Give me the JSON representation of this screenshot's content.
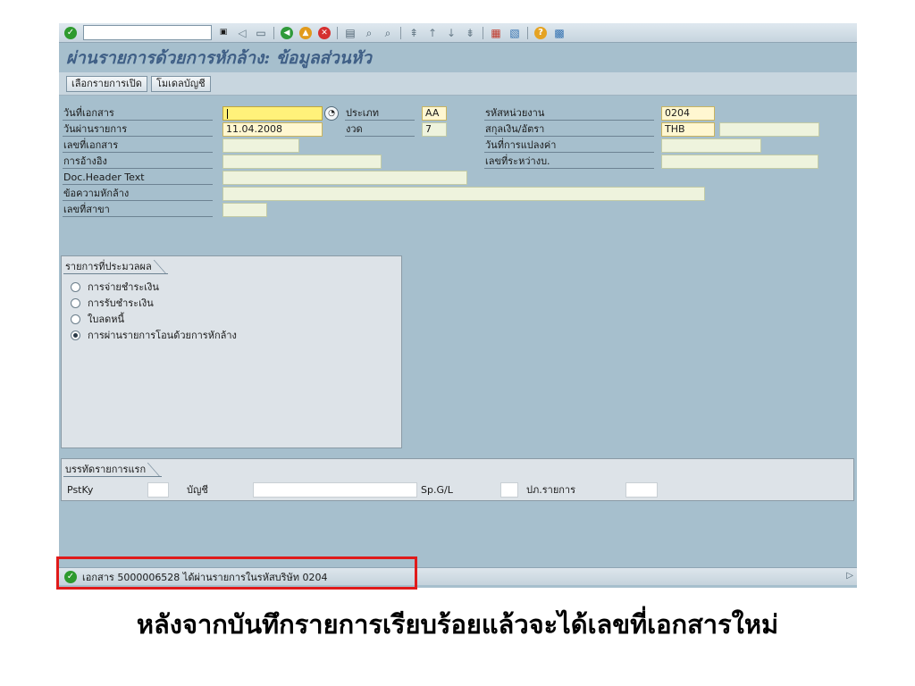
{
  "screen_title": "ผ่านรายการด้วยการหักล้าง: ข้อมูลส่วนหัว",
  "app_toolbar": {
    "open_items_button": "เลือกรายการเปิด",
    "account_model_button": "โมเดลบัญชี"
  },
  "header_fields": {
    "document_date": {
      "label": "วันที่เอกสาร",
      "value": ""
    },
    "posting_date": {
      "label": "วันผ่านรายการ",
      "value": "11.04.2008"
    },
    "document_number": {
      "label": "เลขที่เอกสาร",
      "value": ""
    },
    "reference": {
      "label": "การอ้างอิง",
      "value": ""
    },
    "doc_header_text": {
      "label": "Doc.Header Text",
      "value": ""
    },
    "clearing_text": {
      "label": "ข้อความหักล้าง",
      "value": ""
    },
    "branch_number": {
      "label": "เลขที่สาขา",
      "value": ""
    },
    "type": {
      "label": "ประเภท",
      "value": "AA"
    },
    "period": {
      "label": "งวด",
      "value": "7"
    },
    "company_code": {
      "label": "รหัสหน่วยงาน",
      "value": "0204"
    },
    "currency_rate": {
      "label": "สกุลเงิน/อัตรา",
      "value": "THB",
      "rate": ""
    },
    "translation_date": {
      "label": "วันที่การแปลงค่า",
      "value": ""
    },
    "cross_cc_number": {
      "label": "เลขที่ระหว่างบ.",
      "value": ""
    }
  },
  "processing_group": {
    "title": "รายการที่ประมวลผล",
    "options": [
      {
        "label": "การจ่ายชำระเงิน",
        "selected": false
      },
      {
        "label": "การรับชำระเงิน",
        "selected": false
      },
      {
        "label": "ใบลดหนี้",
        "selected": false
      },
      {
        "label": "การผ่านรายการโอนด้วยการหักล้าง",
        "selected": true
      }
    ]
  },
  "first_line_group": {
    "title": "บรรทัดรายการแรก",
    "pstky_label": "PstKy",
    "account_label": "บัญชี",
    "spgl_label": "Sp.G/L",
    "trans_type_label": "ปภ.รายการ"
  },
  "status_bar": {
    "message": "เอกสาร 5000006528 ได้ผ่านรายการในรหัสบริษัท 0204"
  },
  "caption": "หลังจากบันทึกรายการเรียบร้อยแล้วจะได้เลขที่เอกสารใหม่",
  "colors": {
    "screen_bg": "#a6bfcd",
    "title": "#3f5f86",
    "highlight": "#e01a1a"
  }
}
